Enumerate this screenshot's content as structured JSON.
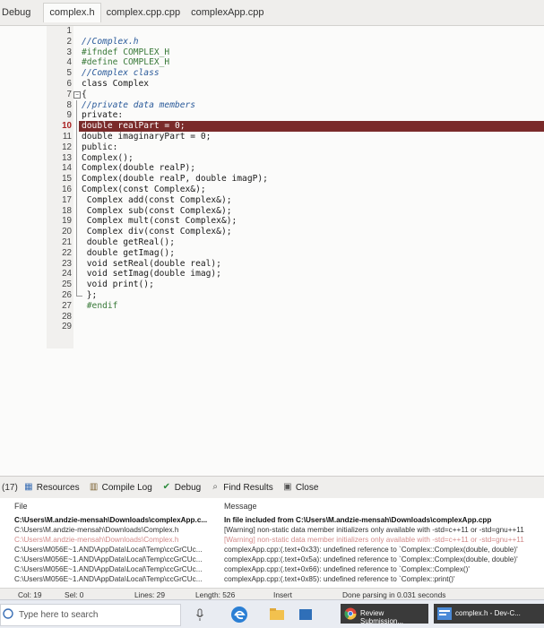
{
  "topbar": {
    "menu_debug": "Debug",
    "tabs": [
      "complex.h",
      "complex.cpp.cpp",
      "complexApp.cpp"
    ]
  },
  "editor": {
    "highlighted_line": "10",
    "lines": [
      {
        "num": "1",
        "code": "",
        "kind": ""
      },
      {
        "num": "2",
        "code": "//Complex.h",
        "kind": "comment"
      },
      {
        "num": "3",
        "code": "#ifndef COMPLEX_H",
        "kind": "directive"
      },
      {
        "num": "4",
        "code": "#define COMPLEX_H",
        "kind": "directive"
      },
      {
        "num": "5",
        "code": "//Complex class",
        "kind": "comment"
      },
      {
        "num": "6",
        "code": "class Complex",
        "kind": ""
      },
      {
        "num": "7",
        "code": "{",
        "kind": ""
      },
      {
        "num": "8",
        "code": "//private data members",
        "kind": "comment"
      },
      {
        "num": "9",
        "code": "private:",
        "kind": ""
      },
      {
        "num": "10",
        "code": "double realPart = 0;",
        "kind": ""
      },
      {
        "num": "11",
        "code": "double imaginaryPart = 0;",
        "kind": ""
      },
      {
        "num": "12",
        "code": "public:",
        "kind": ""
      },
      {
        "num": "13",
        "code": "Complex();",
        "kind": ""
      },
      {
        "num": "14",
        "code": "Complex(double realP);",
        "kind": ""
      },
      {
        "num": "15",
        "code": "Complex(double realP, double imagP);",
        "kind": ""
      },
      {
        "num": "16",
        "code": "Complex(const Complex&);",
        "kind": ""
      },
      {
        "num": "17",
        "code": " Complex add(const Complex&);",
        "kind": ""
      },
      {
        "num": "18",
        "code": " Complex sub(const Complex&);",
        "kind": ""
      },
      {
        "num": "19",
        "code": " Complex mult(const Complex&);",
        "kind": ""
      },
      {
        "num": "20",
        "code": " Complex div(const Complex&);",
        "kind": ""
      },
      {
        "num": "21",
        "code": " double getReal();",
        "kind": ""
      },
      {
        "num": "22",
        "code": " double getImag();",
        "kind": ""
      },
      {
        "num": "23",
        "code": " void setReal(double real);",
        "kind": ""
      },
      {
        "num": "24",
        "code": " void setImag(double imag);",
        "kind": ""
      },
      {
        "num": "25",
        "code": " void print();",
        "kind": ""
      },
      {
        "num": "26",
        "code": " };",
        "kind": ""
      },
      {
        "num": "27",
        "code": " #endif",
        "kind": "directive"
      },
      {
        "num": "28",
        "code": "",
        "kind": ""
      },
      {
        "num": "29",
        "code": "",
        "kind": ""
      }
    ]
  },
  "bottom_tabs": {
    "counter": "(17)",
    "resources": "Resources",
    "compile_log": "Compile Log",
    "debug": "Debug",
    "find_results": "Find Results",
    "close": "Close"
  },
  "messages": {
    "col_file": "File",
    "col_message": "Message",
    "rows": [
      {
        "file": "C:\\Users\\M.andzie-mensah\\Downloads\\complexApp.c...",
        "message": "In file included from C:\\Users\\M.andzie-mensah\\Downloads\\complexApp.cpp",
        "style": "bold"
      },
      {
        "file": "C:\\Users\\M.andzie-mensah\\Downloads\\Complex.h",
        "message": "[Warning] non-static data member initializers only available with -std=c++11 or -std=gnu++11",
        "style": ""
      },
      {
        "file": "C:\\Users\\M.andzie-mensah\\Downloads\\Complex.h",
        "message": "[Warning] non-static data member initializers only available with -std=c++11 or -std=gnu++11",
        "style": "faded"
      },
      {
        "file": "C:\\Users\\M056E~1.AND\\AppData\\Local\\Temp\\ccGrCUc...",
        "message": "complexApp.cpp:(.text+0x33): undefined reference to `Complex::Complex(double, double)'",
        "style": ""
      },
      {
        "file": "C:\\Users\\M056E~1.AND\\AppData\\Local\\Temp\\ccGrCUc...",
        "message": "complexApp.cpp:(.text+0x5a): undefined reference to `Complex::Complex(double, double)'",
        "style": ""
      },
      {
        "file": "C:\\Users\\M056E~1.AND\\AppData\\Local\\Temp\\ccGrCUc...",
        "message": "complexApp.cpp:(.text+0x66): undefined reference to `Complex::Complex()'",
        "style": ""
      },
      {
        "file": "C:\\Users\\M056E~1.AND\\AppData\\Local\\Temp\\ccGrCUc...",
        "message": "complexApp.cpp:(.text+0x85): undefined reference to `Complex::print()'",
        "style": ""
      }
    ]
  },
  "statusbar": {
    "col": "Col: 19",
    "sel": "Sel: 0",
    "lines": "Lines: 29",
    "length": "Length: 526",
    "insert": "Insert",
    "done": "Done parsing in 0.031 seconds"
  },
  "taskbar": {
    "search_placeholder": "Type here to search",
    "chrome_label": "Review Submission...",
    "dev_label": "complex.h - Dev-C..."
  },
  "colors": {
    "highlight_band": "#7a2a2a",
    "comment": "#2a5a9a",
    "directive": "#3a7a3a"
  }
}
